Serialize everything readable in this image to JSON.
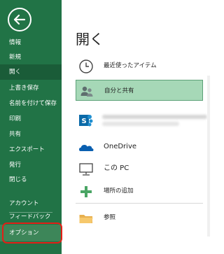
{
  "colors": {
    "sidebar": "#217346",
    "selected": "#1a5c38",
    "highlight": "#e41e16",
    "place_selected": "#a6d8b7"
  },
  "sidebar": {
    "back_icon": "back-arrow-icon",
    "items": [
      {
        "label": "情報"
      },
      {
        "label": "新規"
      },
      {
        "label": "開く"
      },
      {
        "label": "上書き保存"
      },
      {
        "label": "名前を付けて保存"
      },
      {
        "label": "印刷"
      },
      {
        "label": "共有"
      },
      {
        "label": "エクスポート"
      },
      {
        "label": "発行"
      },
      {
        "label": "閉じる"
      }
    ],
    "account": "アカウント",
    "feedback": "フィードバック",
    "options": "オプション"
  },
  "main": {
    "title": "開く",
    "places": [
      {
        "label": "最近使ったアイテム",
        "icon": "clock-icon"
      },
      {
        "label": "自分と共有",
        "icon": "shared-people-icon"
      },
      {
        "label": "",
        "icon": "sharepoint-icon"
      },
      {
        "label": "OneDrive",
        "icon": "onedrive-cloud-icon"
      },
      {
        "label": "この PC",
        "icon": "this-pc-icon"
      },
      {
        "label": "場所の追加",
        "icon": "plus-icon"
      },
      {
        "label": "参照",
        "icon": "folder-icon"
      }
    ]
  }
}
